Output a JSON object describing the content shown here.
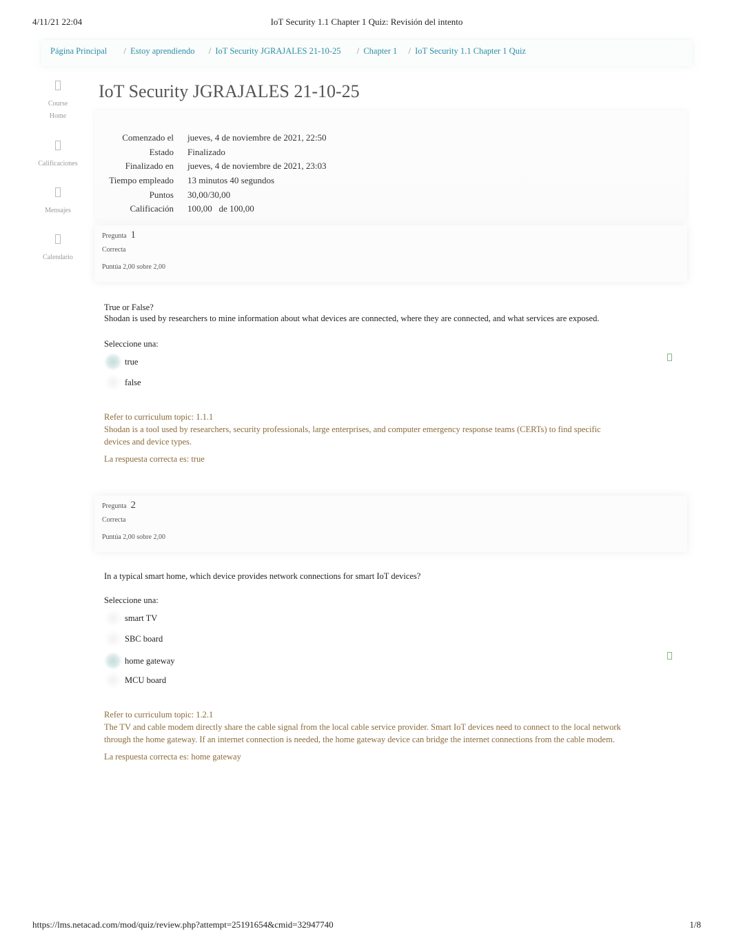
{
  "print_header": {
    "datetime": "4/11/21 22:04",
    "title": "IoT Security 1.1 Chapter 1 Quiz: Revisión del intento"
  },
  "breadcrumb": [
    {
      "label": "Página Principal"
    },
    {
      "label": "Estoy aprendiendo"
    },
    {
      "label": "IoT Security JGRAJALES 21-10-25"
    },
    {
      "label": "Chapter 1"
    },
    {
      "label": "IoT Security 1.1 Chapter 1 Quiz"
    }
  ],
  "breadcrumb_separator": "/",
  "sidebar": {
    "items": [
      {
        "label_line1": "Course",
        "label_line2": "Home",
        "icon": "home-icon"
      },
      {
        "label_line1": "Calificaciones",
        "label_line2": "",
        "icon": "grades-icon"
      },
      {
        "label_line1": "Mensajes",
        "label_line2": "",
        "icon": "messages-icon"
      },
      {
        "label_line1": "Calendario",
        "label_line2": "",
        "icon": "calendar-icon"
      }
    ]
  },
  "page_title": "IoT Security JGRAJALES 21-10-25",
  "summary": [
    {
      "key": "Comenzado el",
      "value": "jueves, 4 de noviembre de 2021, 22:50"
    },
    {
      "key": "Estado",
      "value": "Finalizado"
    },
    {
      "key": "Finalizado en",
      "value": "jueves, 4 de noviembre de 2021, 23:03"
    },
    {
      "key": "Tiempo empleado",
      "value": "13 minutos 40 segundos"
    },
    {
      "key": "Puntos",
      "value": "30,00/30,00"
    },
    {
      "key": "Calificación",
      "value": "100,00   de 100,00"
    }
  ],
  "questions": [
    {
      "label": "Pregunta",
      "number": "1",
      "state": "Correcta",
      "grade": "Puntúa 2,00 sobre 2,00",
      "text_line1": "True or False?",
      "text_line2": "Shodan is used by researchers to mine information about what devices are connected, where they are connected, and what services are exposed.",
      "prompt": "Seleccione una:",
      "answers": [
        {
          "label": "true",
          "selected": true
        },
        {
          "label": "false",
          "selected": false
        }
      ],
      "feedback_topic": "Refer to curriculum topic: 1.1.1",
      "feedback_text": "Shodan is a tool used by researchers, security professionals, large enterprises, and computer emergency response teams (CERTs) to find specific devices and device types.",
      "right_answer": "La respuesta correcta es: true"
    },
    {
      "label": "Pregunta",
      "number": "2",
      "state": "Correcta",
      "grade": "Puntúa 2,00 sobre 2,00",
      "text_line1": "In a typical smart home, which device provides network connections for smart IoT devices?",
      "text_line2": "",
      "prompt": "Seleccione una:",
      "answers": [
        {
          "label": "smart TV",
          "selected": false
        },
        {
          "label": "SBC board",
          "selected": false
        },
        {
          "label": "home gateway",
          "selected": true
        },
        {
          "label": "MCU board",
          "selected": false
        }
      ],
      "feedback_topic": "Refer to curriculum topic: 1.2.1",
      "feedback_text": "The TV and cable modem directly share the cable signal from the local cable service provider. Smart IoT devices need to connect to the local network through the home gateway. If an internet connection is needed, the home gateway device can bridge the internet connections from the cable modem.",
      "right_answer": "La respuesta correcta es: home gateway"
    }
  ],
  "print_footer": {
    "url": "https://lms.netacad.com/mod/quiz/review.php?attempt=25191654&cmid=32947740",
    "page": "1/8"
  },
  "colors": {
    "link": "#2a8fa5",
    "feedback": "#8b6b3a",
    "check": "#8bb38b"
  }
}
